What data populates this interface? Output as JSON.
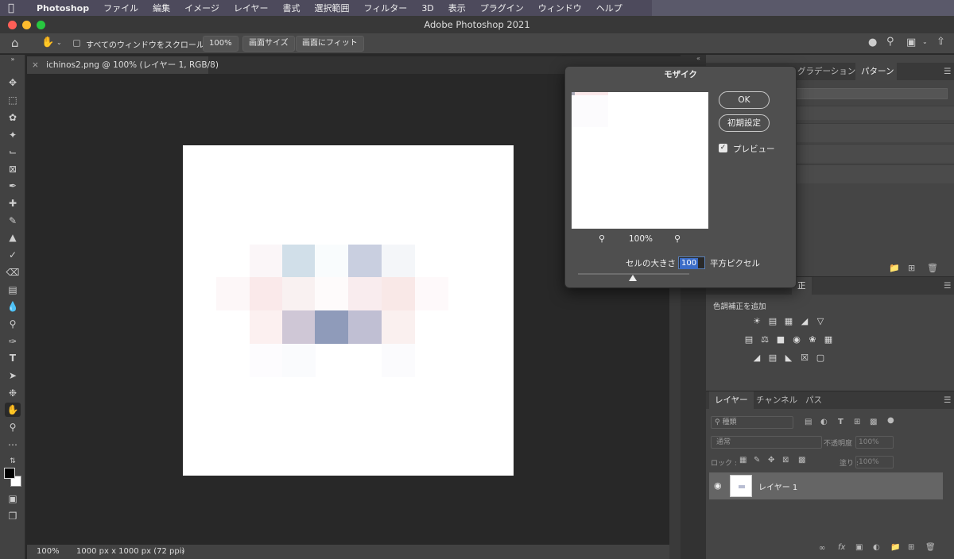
{
  "menubar": {
    "app": "Photoshop",
    "items": [
      "ファイル",
      "編集",
      "イメージ",
      "レイヤー",
      "書式",
      "選択範囲",
      "フィルター",
      "3D",
      "表示",
      "プラグイン",
      "ウィンドウ",
      "ヘルプ"
    ]
  },
  "window": {
    "title": "Adobe Photoshop 2021"
  },
  "options": {
    "scroll_all_label": "すべてのウィンドウをスクロール",
    "zoom_100_label": "100%",
    "fit_screen_label": "画面サイズ",
    "fill_screen_label": "画面にフィット"
  },
  "document": {
    "tab_title": "ichinos2.png @ 100% (レイヤー 1, RGB/8)"
  },
  "status": {
    "zoom": "100%",
    "doc_info": "1000 px x 1000 px (72 ppi)"
  },
  "mosaic_dialog": {
    "title": "モザイク",
    "ok_label": "OK",
    "reset_label": "初期設定",
    "preview_label": "プレビュー",
    "preview_checked": true,
    "zoom_level": "100%",
    "cell_size_label": "セルの大きさ :",
    "cell_size_value": "100",
    "cell_size_unit": "平方ピクセル"
  },
  "top_panel": {
    "tabs": [
      "グラデーション",
      "パターン"
    ]
  },
  "adjustments": {
    "partial_tab": "正",
    "add_label": "色調補正を追加"
  },
  "layers_panel": {
    "tabs": [
      "レイヤー",
      "チャンネル",
      "パス"
    ],
    "filter_placeholder": "種類",
    "blend_mode": "通常",
    "opacity_label": "不透明度 :",
    "opacity_value": "100%",
    "lock_label": "ロック :",
    "fill_label": "塗り :",
    "fill_value": "100%",
    "layers": [
      {
        "name": "レイヤー 1",
        "visible": true
      }
    ]
  },
  "colors": {
    "accent": "#3b6cc7",
    "menubar": "#4d4a5c",
    "mosaic_cells": [
      "#fbf6f8",
      "#d1dfe9",
      "#f9fcfd",
      "#c9cfe0",
      "#f4f6f9",
      "#fdf7f8",
      "#fae9ea",
      "#f9f1f1",
      "#fefbfb",
      "#f9ecee",
      "#f9e8e7",
      "#fef9fa",
      "#cfc7d6",
      "#8f9bba",
      "#c0bfd3",
      "#faf0ef",
      "#fdfcfe",
      "#fafbfd"
    ]
  }
}
